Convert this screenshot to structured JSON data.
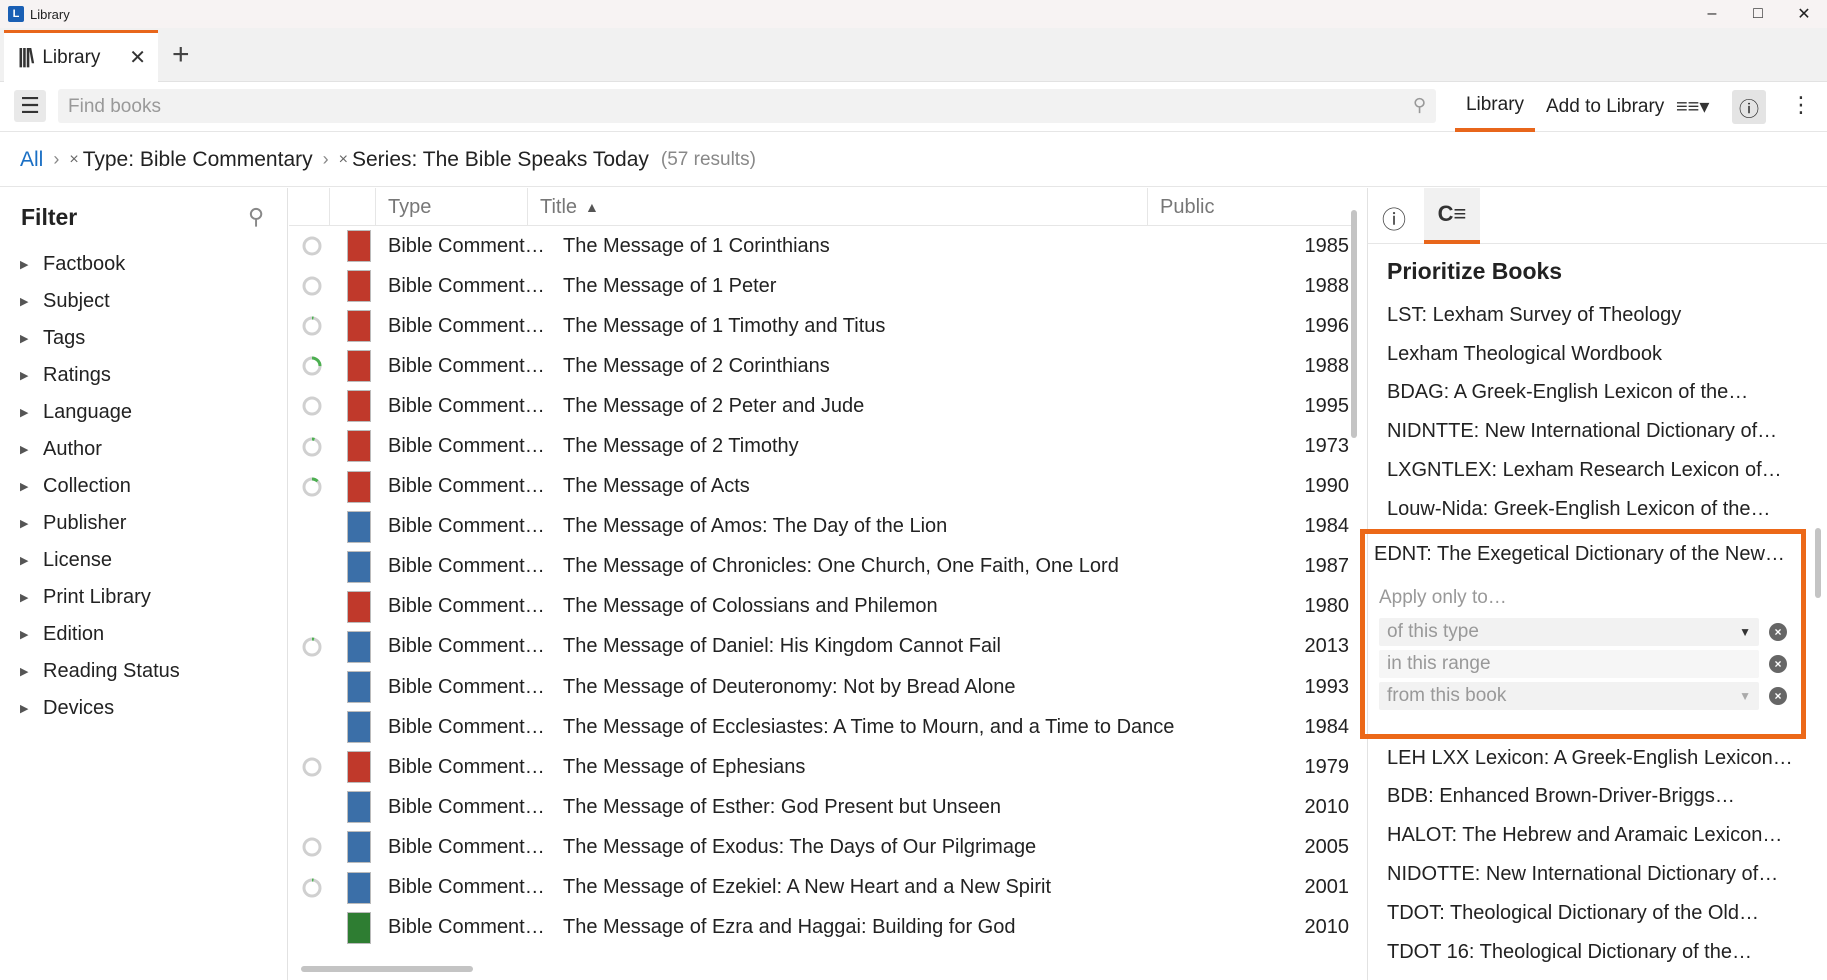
{
  "window": {
    "title": "Library"
  },
  "tab": {
    "label": "Library"
  },
  "toolbar": {
    "search_placeholder": "Find books",
    "library_label": "Library",
    "add_label": "Add to Library"
  },
  "breadcrumb": {
    "all": "All",
    "filter1": "Type: Bible Commentary",
    "filter2": "Series: The Bible Speaks Today",
    "count": "(57 results)"
  },
  "filter": {
    "title": "Filter",
    "items": [
      "Factbook",
      "Subject",
      "Tags",
      "Ratings",
      "Language",
      "Author",
      "Collection",
      "Publisher",
      "License",
      "Print Library",
      "Edition",
      "Reading Status",
      "Devices"
    ]
  },
  "columns": {
    "type": "Type",
    "title": "Title",
    "published": "Public"
  },
  "books": [
    {
      "type": "Bible Comment…",
      "title": "The Message of 1 Corinthians",
      "year": "1985",
      "progress": 0.0,
      "cover": "#c0392b"
    },
    {
      "type": "Bible Comment…",
      "title": "The Message of 1 Peter",
      "year": "1988",
      "progress": 0.0,
      "cover": "#c0392b"
    },
    {
      "type": "Bible Comment…",
      "title": "The Message of 1 Timothy and Titus",
      "year": "1996",
      "progress": 0.03,
      "cover": "#c0392b"
    },
    {
      "type": "Bible Comment…",
      "title": "The Message of 2 Corinthians",
      "year": "1988",
      "progress": 0.25,
      "cover": "#c0392b"
    },
    {
      "type": "Bible Comment…",
      "title": "The Message of 2 Peter and Jude",
      "year": "1995",
      "progress": 0.0,
      "cover": "#c0392b"
    },
    {
      "type": "Bible Comment…",
      "title": "The Message of 2 Timothy",
      "year": "1973",
      "progress": 0.05,
      "cover": "#c0392b"
    },
    {
      "type": "Bible Comment…",
      "title": "The Message of Acts",
      "year": "1990",
      "progress": 0.12,
      "cover": "#c0392b"
    },
    {
      "type": "Bible Comment…",
      "title": "The Message of Amos: The Day of the Lion",
      "year": "1984",
      "progress": null,
      "cover": "#3b6fa8"
    },
    {
      "type": "Bible Comment…",
      "title": "The Message of Chronicles: One Church, One Faith, One Lord",
      "year": "1987",
      "progress": null,
      "cover": "#3b6fa8"
    },
    {
      "type": "Bible Comment…",
      "title": "The Message of Colossians and Philemon",
      "year": "1980",
      "progress": null,
      "cover": "#c0392b"
    },
    {
      "type": "Bible Comment…",
      "title": "The Message of Daniel: His Kingdom Cannot Fail",
      "year": "2013",
      "progress": 0.04,
      "cover": "#3b6fa8"
    },
    {
      "type": "Bible Comment…",
      "title": "The Message of Deuteronomy: Not by Bread Alone",
      "year": "1993",
      "progress": null,
      "cover": "#3b6fa8"
    },
    {
      "type": "Bible Comment…",
      "title": "The Message of Ecclesiastes: A Time to Mourn, and a Time to Dance",
      "year": "1984",
      "progress": null,
      "cover": "#3b6fa8"
    },
    {
      "type": "Bible Comment…",
      "title": "The Message of Ephesians",
      "year": "1979",
      "progress": 0.0,
      "cover": "#c0392b"
    },
    {
      "type": "Bible Comment…",
      "title": "The Message of Esther: God Present but Unseen",
      "year": "2010",
      "progress": null,
      "cover": "#3b6fa8"
    },
    {
      "type": "Bible Comment…",
      "title": "The Message of Exodus: The Days of Our Pilgrimage",
      "year": "2005",
      "progress": 0.0,
      "cover": "#3b6fa8"
    },
    {
      "type": "Bible Comment…",
      "title": "The Message of Ezekiel: A New Heart and a New Spirit",
      "year": "2001",
      "progress": 0.03,
      "cover": "#3b6fa8"
    },
    {
      "type": "Bible Comment…",
      "title": "The Message of Ezra and Haggai: Building for God",
      "year": "2010",
      "progress": null,
      "cover": "#2e7d32"
    }
  ],
  "panel": {
    "title": "Prioritize Books",
    "items_before": [
      "LST: Lexham Survey of Theology",
      "Lexham Theological Wordbook",
      "BDAG: A Greek-English Lexicon of the…",
      "NIDNTTE: New International Dictionary of…",
      "LXGNTLEX: Lexham Research Lexicon of…",
      "Louw-Nida: Greek-English Lexicon of the…"
    ],
    "selected": {
      "title": "EDNT: The Exegetical Dictionary of the New…",
      "apply_label": "Apply only to…",
      "type_field": "of this type",
      "range_field": "in this range",
      "book_field": "from this book"
    },
    "items_after": [
      "LEH LXX Lexicon: A Greek-English Lexicon…",
      "BDB: Enhanced Brown-Driver-Briggs…",
      "HALOT: The Hebrew and Aramaic Lexicon…",
      "NIDOTTE: New International Dictionary of…",
      "TDOT: Theological Dictionary of the Old…",
      "TDOT 16: Theological Dictionary of the…"
    ]
  },
  "colors": {
    "accent": "#e8661b",
    "link": "#1a6fc4",
    "progress": "#4caf50"
  }
}
